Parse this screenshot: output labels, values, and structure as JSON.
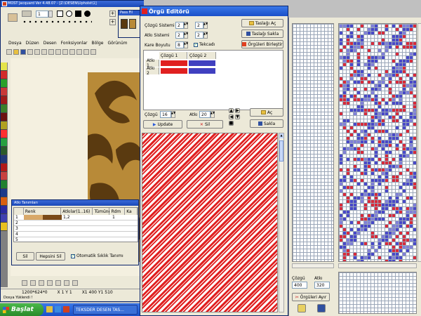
{
  "main_app": {
    "title": "MOST Jacquard   Ver 4.48.07 - [Z:\\DESEN\\Upholst\\1]",
    "toolbar": {
      "value": "1"
    },
    "menu": [
      "Dosya",
      "Düzen",
      "Desen",
      "Fonksiyonlar",
      "Bölge",
      "Görünüm"
    ],
    "statusbar": {
      "size": "1200*624*0",
      "pos": "X 1 Y 1",
      "coords": "X1 400 Y1 510"
    },
    "footer": "Dosya Yüklendi !",
    "palette_colors": [
      "#e4e44a",
      "#d22a2a",
      "#2aa02a",
      "#c83838",
      "#a01a1a",
      "#3a7f2a",
      "#6b1010",
      "#b0a020",
      "#ff3030",
      "#28a040",
      "#2a5a2a",
      "#203878",
      "#b01a1a",
      "#c84040",
      "#208030",
      "#1a3a8a",
      "#d86010",
      "#2a2aa0",
      "#4040b0",
      "#e8c020"
    ]
  },
  "side_window": {
    "title": "Pass Fil"
  },
  "atki_panel": {
    "title": "Atkı Tanımları",
    "columns": [
      "",
      "Renk",
      "Atkılar(1..16)",
      "Tümüne",
      "Rdm",
      "Ka"
    ],
    "rows": [
      {
        "num": "1",
        "atki": "1,2",
        "rdm": "1"
      },
      {
        "num": "2",
        "atki": "",
        "rdm": ""
      },
      {
        "num": "3",
        "atki": "",
        "rdm": ""
      },
      {
        "num": "4",
        "atki": "",
        "rdm": ""
      },
      {
        "num": "5",
        "atki": "",
        "rdm": ""
      }
    ],
    "delete_label": "Sil",
    "delete_all_label": "Hepsini Sil",
    "auto_sort_label": "Otomatik Sıklık Tanımı"
  },
  "taskbar": {
    "start_label": "Başlat",
    "task1": "TEKSDER DESEN TAS..."
  },
  "orgu_editor": {
    "title": "Örgü Editörü",
    "cozgu_sistemi_label": "Çözgü Sistemi",
    "cozgu_sistemi_1": "2",
    "cozgu_sistemi_2": "2",
    "atki_sistemi_label": "Atkı Sistemi",
    "atki_sistemi_1": "2",
    "atki_sistemi_2": "2",
    "kare_boyutu_label": "Kare Boyutu",
    "kare_boyutu_value": "8",
    "tekcadir_label": "Tekcadı",
    "tasla_ac_label": "Taslağı Aç",
    "tasla_sakla_label": "Taslağı Sakla",
    "orguleri_birlestir_label": "Örgüleri Birleştir",
    "col_cozgu1": "Çözgü 1",
    "col_cozgu2": "Çözgü 2",
    "row_atki1": "Atkı 1",
    "row_atki2": "Atkı 2",
    "cozgu_label": "Çözgü",
    "cozgu_value": "16",
    "atki_label": "Atkı",
    "atki_value": "20",
    "update_label": "Update",
    "sil_label": "Sil",
    "ac_label": "Aç",
    "sakla_label": "Sakla"
  },
  "right_panel": {
    "cozgu_label": "Çözgü",
    "cozgu_value": "400",
    "atki_label": "Atkı",
    "atki_value": "320",
    "orguleri_ayir_label": "Örgüleri Ayır"
  }
}
